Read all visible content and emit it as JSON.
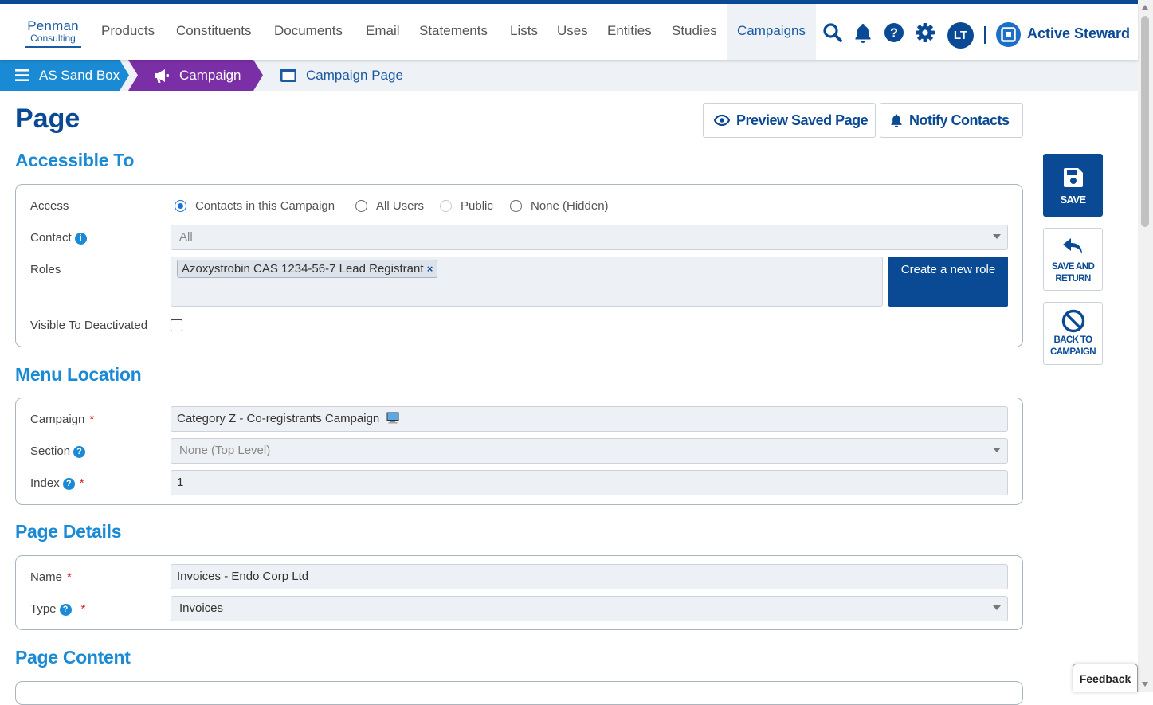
{
  "brand": {
    "logo_line1": "Penman",
    "logo_line2": "Consulting",
    "app_name": "Active Steward"
  },
  "nav": {
    "items": [
      "Products",
      "Constituents",
      "Documents",
      "Email",
      "Statements",
      "Lists",
      "Uses",
      "Entities",
      "Studies",
      "Campaigns"
    ],
    "active": "Campaigns",
    "user_initials": "LT"
  },
  "breadcrumb": {
    "root": "AS Sand Box",
    "campaign": "Campaign",
    "page": "Campaign Page"
  },
  "page": {
    "title": "Page"
  },
  "actions": {
    "preview": "Preview Saved Page",
    "notify": "Notify Contacts"
  },
  "side_actions": {
    "save": "SAVE",
    "save_return_1": "SAVE AND",
    "save_return_2": "RETURN",
    "back_1": "BACK TO",
    "back_2": "CAMPAIGN"
  },
  "accessible": {
    "heading": "Accessible To",
    "access_label": "Access",
    "access_options": [
      "Contacts in this Campaign",
      "All Users",
      "Public",
      "None (Hidden)"
    ],
    "access_selected": "Contacts in this Campaign",
    "contact_label": "Contact",
    "contact_value": "All",
    "roles_label": "Roles",
    "role_tag": "Azoxystrobin CAS 1234-56-7 Lead Registrant",
    "create_role": "Create a new role",
    "visible_label": "Visible To Deactivated",
    "visible_checked": false
  },
  "menu_location": {
    "heading": "Menu Location",
    "campaign_label": "Campaign",
    "campaign_value": "Category Z - Co-registrants Campaign",
    "section_label": "Section",
    "section_value": "None (Top Level)",
    "index_label": "Index",
    "index_value": "1"
  },
  "details": {
    "heading": "Page Details",
    "name_label": "Name",
    "name_value": "Invoices - Endo Corp Ltd",
    "type_label": "Type",
    "type_value": "Invoices"
  },
  "content": {
    "heading": "Page Content"
  },
  "feedback": "Feedback",
  "colors": {
    "primary": "#0a4a94",
    "accent": "#1a8ad4",
    "campaign": "#7b2fa6"
  }
}
